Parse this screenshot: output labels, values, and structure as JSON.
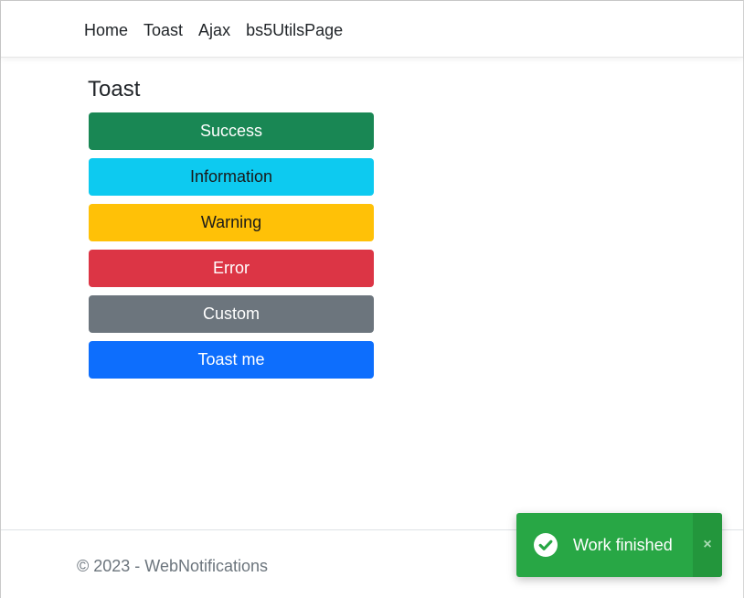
{
  "nav": {
    "items": [
      "Home",
      "Toast",
      "Ajax",
      "bs5UtilsPage"
    ]
  },
  "main": {
    "title": "Toast",
    "buttons": {
      "success": "Success",
      "information": "Information",
      "warning": "Warning",
      "error": "Error",
      "custom": "Custom",
      "toast_me": "Toast me"
    }
  },
  "footer": {
    "text": "© 2023 - WebNotifications"
  },
  "toast": {
    "message": "Work finished",
    "close_label": "×",
    "icon": "check-circle-icon",
    "color": "#28a745"
  },
  "colors": {
    "success": "#198754",
    "info": "#0dcaf0",
    "warning": "#ffc107",
    "danger": "#dc3545",
    "secondary": "#6c757d",
    "primary": "#0d6efd"
  }
}
